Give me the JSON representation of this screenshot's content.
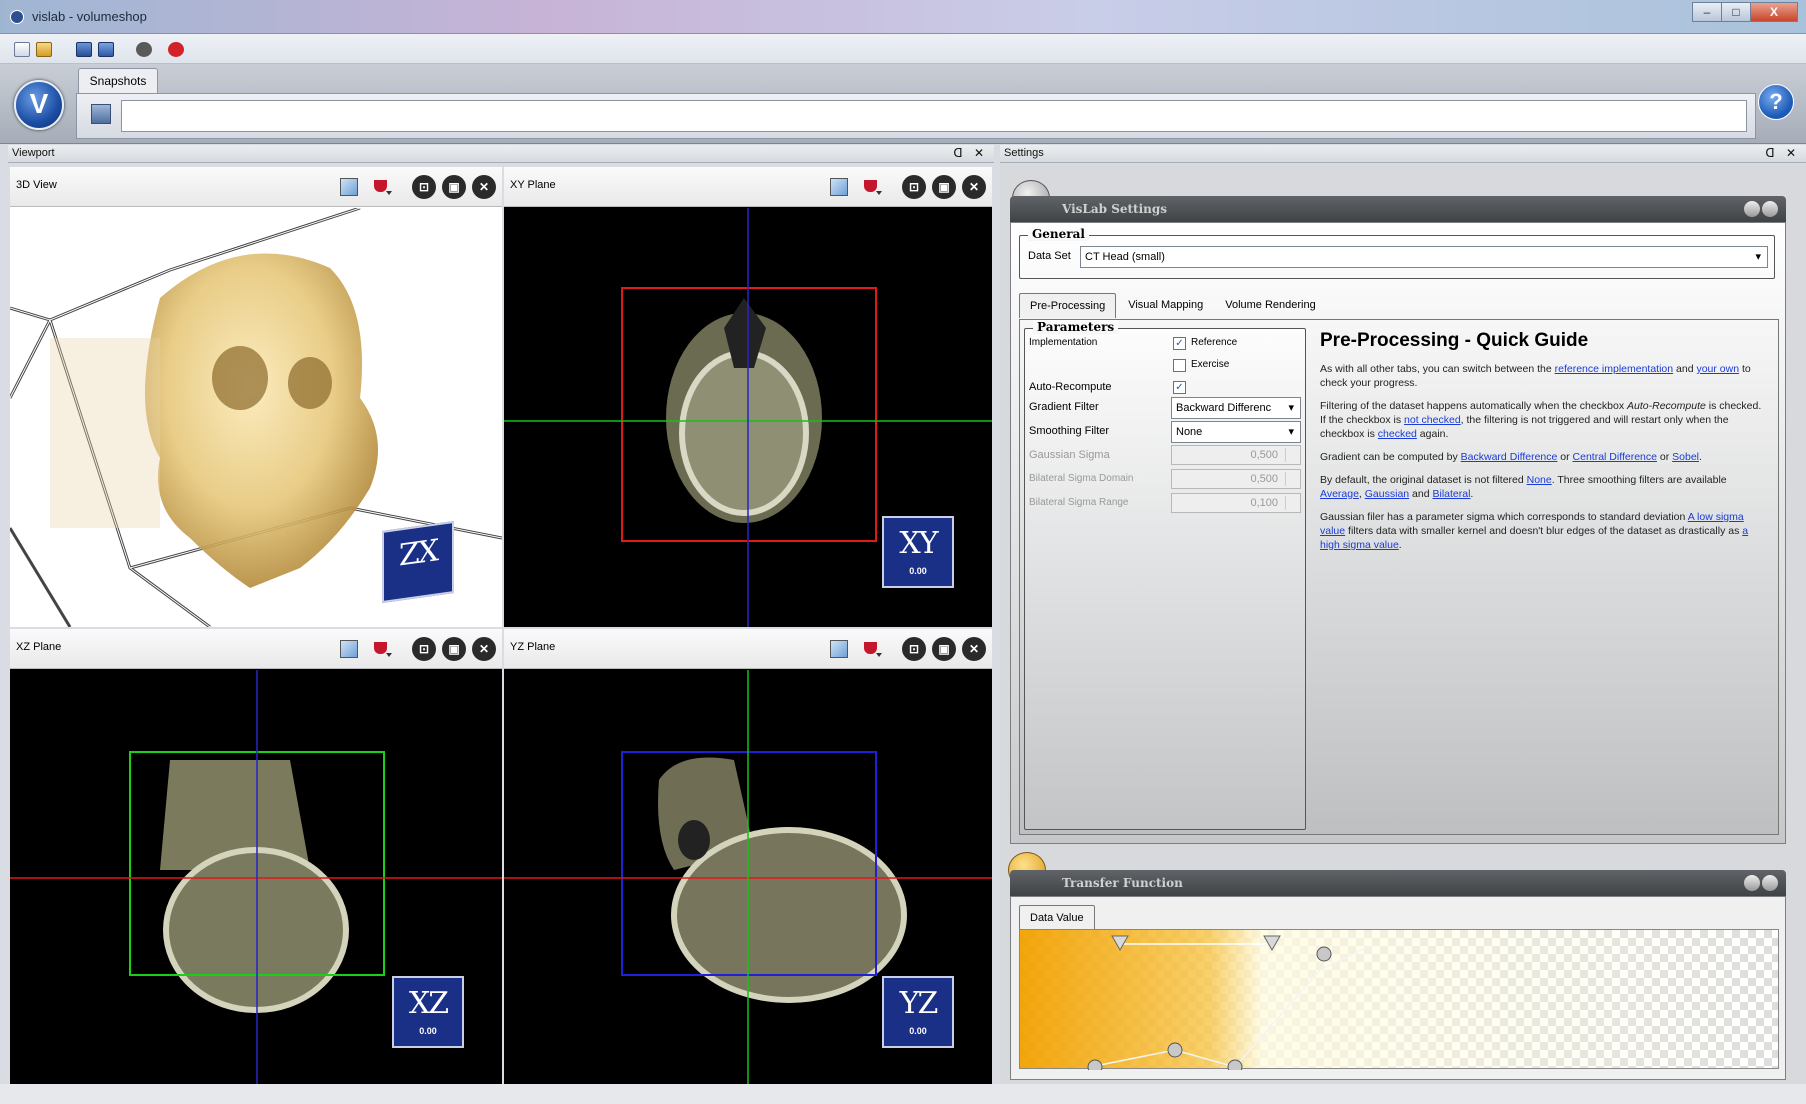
{
  "window": {
    "title": "vislab - volumeshop",
    "min": "–",
    "max": "□",
    "close": "X"
  },
  "ribbon": {
    "orb_label": "V",
    "tab_label": "Snapshots",
    "help_label": "?"
  },
  "viewport_panel": {
    "title": "Viewport",
    "controls": "ᗡ ✕"
  },
  "settings_panel": {
    "title": "Settings",
    "controls": "ᗡ ✕"
  },
  "views": {
    "v3d": {
      "title": "3D View",
      "badge": "ZX"
    },
    "xy": {
      "title": "XY Plane",
      "badge": "XY",
      "value": "0.00"
    },
    "xz": {
      "title": "XZ Plane",
      "badge": "XZ",
      "value": "0.00"
    },
    "yz": {
      "title": "YZ Plane",
      "badge": "YZ",
      "value": "0.00"
    },
    "tool_icons": [
      "image-icon",
      "color-drop-icon",
      "zoom-fit-icon",
      "stop-icon",
      "close-icon"
    ],
    "tool_glyphs": [
      "⊡",
      "▣",
      "✕"
    ]
  },
  "vislab_settings": {
    "header": "VisLab Settings",
    "general_legend": "General",
    "dataset_label": "Data Set",
    "dataset_value": "CT Head (small)",
    "tabs": [
      "Pre-Processing",
      "Visual Mapping",
      "Volume Rendering"
    ],
    "params_legend": "Parameters",
    "params": {
      "implementation": "Implementation",
      "reference": "Reference",
      "exercise": "Exercise",
      "auto_recompute": "Auto-Recompute",
      "gradient_filter": "Gradient Filter",
      "gradient_value": "Backward Differenc",
      "smoothing_filter": "Smoothing Filter",
      "smoothing_value": "None",
      "gaussian_sigma": "Gaussian Sigma",
      "gaussian_value": "0,500",
      "bilateral_domain": "Bilateral Sigma Domain",
      "bilateral_domain_value": "0,500",
      "bilateral_range": "Bilateral Sigma Range",
      "bilateral_range_value": "0,100"
    },
    "guide": {
      "title": "Pre-Processing - Quick Guide",
      "p1_a": "As with all other tabs, you can switch between the ",
      "p1_link1": "reference implementation",
      "p1_b": " and ",
      "p1_link2": "your own",
      "p1_c": " to check your progress.",
      "p2_a": "Filtering of the dataset happens automatically when the checkbox ",
      "p2_em": "Auto-Recompute",
      "p2_b": " is checked. If the checkbox is ",
      "p2_link1": "not checked",
      "p2_c": ", the filtering is not triggered and will restart only when the checkbox is ",
      "p2_link2": "checked",
      "p2_d": " again.",
      "p3_a": "Gradient can be computed by ",
      "p3_link1": "Backward Difference",
      "p3_b": " or ",
      "p3_link2": "Central Difference",
      "p3_c": " or ",
      "p3_link3": "Sobel",
      "p3_d": ".",
      "p4_a": "By default, the original dataset is not filtered ",
      "p4_link1": "None",
      "p4_b": ". Three smoothing filters are available ",
      "p4_link2": "Average",
      "p4_c": ", ",
      "p4_link3": "Gaussian",
      "p4_d": " and ",
      "p4_link4": "Bilateral",
      "p4_e": ".",
      "p5_a": "Gaussian filer has a parameter sigma which corresponds to standard deviation ",
      "p5_link1": "A low sigma value",
      "p5_b": " filters data with smaller kernel and doesn't blur edges of the dataset as drastically as ",
      "p5_link2": "a high sigma value",
      "p5_c": "."
    }
  },
  "transfer_function": {
    "header": "Transfer Function",
    "tab": "Data Value",
    "colors": {
      "accent": "#f2a100",
      "end": "#fffce0"
    }
  }
}
